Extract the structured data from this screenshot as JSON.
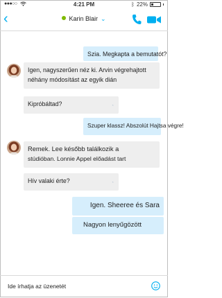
{
  "status_bar": {
    "time": "4:21 PM",
    "battery": "22%"
  },
  "header": {
    "contact_name": "Karin Blair"
  },
  "messages": [
    {
      "text": "Szia. Megkapta a bemutatót?",
      "dir": "out"
    },
    {
      "lines": [
        "Igen, nagyszerűen néz ki. Arvin végrehajtott",
        "néhány módosítást az egyik dián"
      ],
      "dir": "in"
    },
    {
      "text": "Kipróbáltad?",
      "dir": "in"
    },
    {
      "text": "Szuper klassz! Abszolút Hajtsa végre!",
      "dir": "out"
    },
    {
      "lines": [
        "Remek. Lee később találkozik a",
        "stúdióban. Lonnie Appel előadást tart"
      ],
      "dir": "in"
    },
    {
      "text": "Hív valaki érte?",
      "dir": "in"
    },
    {
      "text": "Igen. Sheeree és Sara",
      "dir": "out"
    },
    {
      "text": "Nagyon lenyűgözött",
      "dir": "out"
    }
  ],
  "compose": {
    "placeholder": "Ide írhatja az üzenetét"
  },
  "colors": {
    "accent": "#00aff0",
    "incoming_bubble": "#eeeeee",
    "outgoing_bubble": "#d6eefc",
    "presence": "#7fba00"
  }
}
